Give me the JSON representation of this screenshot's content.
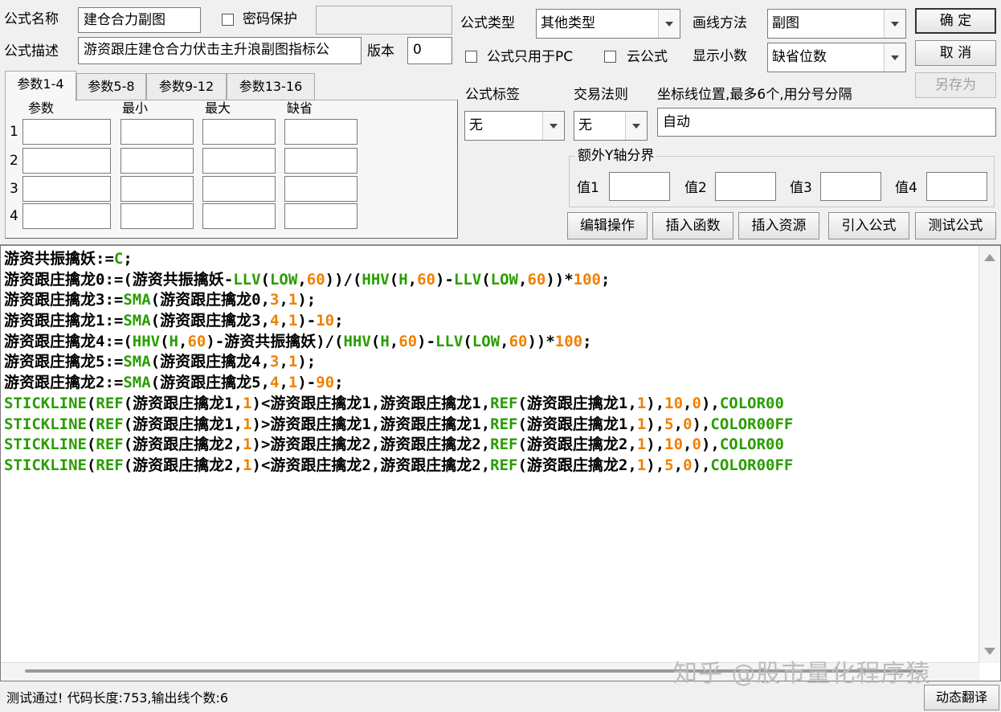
{
  "form": {
    "name_label": "公式名称",
    "name_value": "建仓合力副图",
    "password_label": "密码保护",
    "password_value": "",
    "desc_label": "公式描述",
    "desc_value": "游资跟庄建仓合力伏击主升浪副图指标公",
    "version_label": "版本",
    "version_value": "0",
    "type_label": "公式类型",
    "type_value": "其他类型",
    "draw_label": "画线方法",
    "draw_value": "副图",
    "pc_only_label": "公式只用于PC",
    "cloud_label": "云公式",
    "decimal_label": "显示小数",
    "decimal_value": "缺省位数",
    "tag_label": "公式标签",
    "tag_value": "无",
    "trade_label": "交易法则",
    "trade_value": "无",
    "axis_label": "坐标线位置,最多6个,用分号分隔",
    "axis_value": "自动",
    "yaxis_group": "额外Y轴分界",
    "v1": "值1",
    "v2": "值2",
    "v3": "值3",
    "v4": "值4"
  },
  "buttons": {
    "ok": "确 定",
    "cancel": "取 消",
    "save_as": "另存为",
    "edit_ops": "编辑操作",
    "insert_func": "插入函数",
    "insert_res": "插入资源",
    "import_formula": "引入公式",
    "test_formula": "测试公式",
    "dynamic_translate": "动态翻译"
  },
  "tabs": [
    "参数1-4",
    "参数5-8",
    "参数9-12",
    "参数13-16"
  ],
  "params": {
    "headers": [
      "参数",
      "最小",
      "最大",
      "缺省"
    ],
    "rows": [
      "1",
      "2",
      "3",
      "4"
    ]
  },
  "colors": {
    "func": "#2a9d00",
    "num": "#f08000",
    "text": "#000000"
  },
  "code_lines": [
    [
      [
        "游资共振擒妖:=",
        "t"
      ],
      [
        "C",
        "f"
      ],
      [
        ";",
        "t"
      ]
    ],
    [
      [
        "游资跟庄擒龙0:=(游资共振擒妖-",
        "t"
      ],
      [
        "LLV",
        "f"
      ],
      [
        "(",
        "t"
      ],
      [
        "LOW",
        "f"
      ],
      [
        ",",
        "t"
      ],
      [
        "60",
        "n"
      ],
      [
        "))/(",
        "t"
      ],
      [
        "HHV",
        "f"
      ],
      [
        "(",
        "t"
      ],
      [
        "H",
        "f"
      ],
      [
        ",",
        "t"
      ],
      [
        "60",
        "n"
      ],
      [
        ")-",
        "t"
      ],
      [
        "LLV",
        "f"
      ],
      [
        "(",
        "t"
      ],
      [
        "LOW",
        "f"
      ],
      [
        ",",
        "t"
      ],
      [
        "60",
        "n"
      ],
      [
        "))*",
        "t"
      ],
      [
        "100",
        "n"
      ],
      [
        ";",
        "t"
      ]
    ],
    [
      [
        "游资跟庄擒龙3:=",
        "t"
      ],
      [
        "SMA",
        "f"
      ],
      [
        "(游资跟庄擒龙0,",
        "t"
      ],
      [
        "3",
        "n"
      ],
      [
        ",",
        "t"
      ],
      [
        "1",
        "n"
      ],
      [
        ");",
        "t"
      ]
    ],
    [
      [
        "游资跟庄擒龙1:=",
        "t"
      ],
      [
        "SMA",
        "f"
      ],
      [
        "(游资跟庄擒龙3,",
        "t"
      ],
      [
        "4",
        "n"
      ],
      [
        ",",
        "t"
      ],
      [
        "1",
        "n"
      ],
      [
        ")-",
        "t"
      ],
      [
        "10",
        "n"
      ],
      [
        ";",
        "t"
      ]
    ],
    [
      [
        "游资跟庄擒龙4:=(",
        "t"
      ],
      [
        "HHV",
        "f"
      ],
      [
        "(",
        "t"
      ],
      [
        "H",
        "f"
      ],
      [
        ",",
        "t"
      ],
      [
        "60",
        "n"
      ],
      [
        ")-游资共振擒妖)/(",
        "t"
      ],
      [
        "HHV",
        "f"
      ],
      [
        "(",
        "t"
      ],
      [
        "H",
        "f"
      ],
      [
        ",",
        "t"
      ],
      [
        "60",
        "n"
      ],
      [
        ")-",
        "t"
      ],
      [
        "LLV",
        "f"
      ],
      [
        "(",
        "t"
      ],
      [
        "LOW",
        "f"
      ],
      [
        ",",
        "t"
      ],
      [
        "60",
        "n"
      ],
      [
        "))*",
        "t"
      ],
      [
        "100",
        "n"
      ],
      [
        ";",
        "t"
      ]
    ],
    [
      [
        "游资跟庄擒龙5:=",
        "t"
      ],
      [
        "SMA",
        "f"
      ],
      [
        "(游资跟庄擒龙4,",
        "t"
      ],
      [
        "3",
        "n"
      ],
      [
        ",",
        "t"
      ],
      [
        "1",
        "n"
      ],
      [
        ");",
        "t"
      ]
    ],
    [
      [
        "游资跟庄擒龙2:=",
        "t"
      ],
      [
        "SMA",
        "f"
      ],
      [
        "(游资跟庄擒龙5,",
        "t"
      ],
      [
        "4",
        "n"
      ],
      [
        ",",
        "t"
      ],
      [
        "1",
        "n"
      ],
      [
        ")-",
        "t"
      ],
      [
        "90",
        "n"
      ],
      [
        ";",
        "t"
      ]
    ],
    [
      [
        "STICKLINE",
        "f"
      ],
      [
        "(",
        "t"
      ],
      [
        "REF",
        "f"
      ],
      [
        "(游资跟庄擒龙1,",
        "t"
      ],
      [
        "1",
        "n"
      ],
      [
        ")<游资跟庄擒龙1,游资跟庄擒龙1,",
        "t"
      ],
      [
        "REF",
        "f"
      ],
      [
        "(游资跟庄擒龙1,",
        "t"
      ],
      [
        "1",
        "n"
      ],
      [
        "),",
        "t"
      ],
      [
        "10",
        "n"
      ],
      [
        ",",
        "t"
      ],
      [
        "0",
        "n"
      ],
      [
        "),",
        "t"
      ],
      [
        "COLOR00",
        "f"
      ]
    ],
    [
      [
        "STICKLINE",
        "f"
      ],
      [
        "(",
        "t"
      ],
      [
        "REF",
        "f"
      ],
      [
        "(游资跟庄擒龙1,",
        "t"
      ],
      [
        "1",
        "n"
      ],
      [
        ")>游资跟庄擒龙1,游资跟庄擒龙1,",
        "t"
      ],
      [
        "REF",
        "f"
      ],
      [
        "(游资跟庄擒龙1,",
        "t"
      ],
      [
        "1",
        "n"
      ],
      [
        "),",
        "t"
      ],
      [
        "5",
        "n"
      ],
      [
        ",",
        "t"
      ],
      [
        "0",
        "n"
      ],
      [
        "),",
        "t"
      ],
      [
        "COLOR00FF",
        "f"
      ]
    ],
    [
      [
        "STICKLINE",
        "f"
      ],
      [
        "(",
        "t"
      ],
      [
        "REF",
        "f"
      ],
      [
        "(游资跟庄擒龙2,",
        "t"
      ],
      [
        "1",
        "n"
      ],
      [
        ")>游资跟庄擒龙2,游资跟庄擒龙2,",
        "t"
      ],
      [
        "REF",
        "f"
      ],
      [
        "(游资跟庄擒龙2,",
        "t"
      ],
      [
        "1",
        "n"
      ],
      [
        "),",
        "t"
      ],
      [
        "10",
        "n"
      ],
      [
        ",",
        "t"
      ],
      [
        "0",
        "n"
      ],
      [
        "),",
        "t"
      ],
      [
        "COLOR00",
        "f"
      ]
    ],
    [
      [
        "STICKLINE",
        "f"
      ],
      [
        "(",
        "t"
      ],
      [
        "REF",
        "f"
      ],
      [
        "(游资跟庄擒龙2,",
        "t"
      ],
      [
        "1",
        "n"
      ],
      [
        ")<游资跟庄擒龙2,游资跟庄擒龙2,",
        "t"
      ],
      [
        "REF",
        "f"
      ],
      [
        "(游资跟庄擒龙2,",
        "t"
      ],
      [
        "1",
        "n"
      ],
      [
        "),",
        "t"
      ],
      [
        "5",
        "n"
      ],
      [
        ",",
        "t"
      ],
      [
        "0",
        "n"
      ],
      [
        "),",
        "t"
      ],
      [
        "COLOR00FF",
        "f"
      ]
    ]
  ],
  "status": "测试通过! 代码长度:753,输出线个数:6",
  "watermark": "知乎 @股市量化程序猿"
}
